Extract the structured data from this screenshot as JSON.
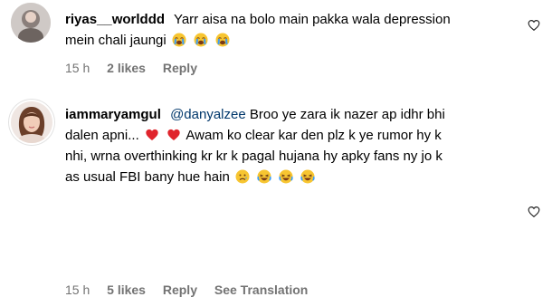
{
  "comments": [
    {
      "username": "riyas__worlddd",
      "text_parts": [
        "Yarr aisa na bolo main pakka wala depression",
        "mein chali jaungi"
      ],
      "emojis": [
        "crying-face",
        "crying-face",
        "crying-face"
      ],
      "time": "15 h",
      "likes": "2 likes",
      "reply": "Reply"
    },
    {
      "username": "iammaryamgul",
      "mention": "@danyalzee",
      "text_lines": [
        "Broo ye zara ik nazer ap idhr bhi",
        "dalen apni...",
        "Awam ko clear kar den plz k ye rumor hy k",
        "nhi, wrna overthinking kr kr k pagal hujana hy apky fans ny jo k",
        "as usual FBI bany hue hain"
      ],
      "emojis": [
        "red-heart",
        "red-heart",
        "sad-face",
        "laughing-face",
        "laughing-face",
        "laughing-face"
      ],
      "time": "15 h",
      "likes": "5 likes",
      "reply": "Reply",
      "translation": "See Translation"
    }
  ],
  "colors": {
    "meta": "#737373",
    "mention": "#00376b",
    "heart_outline": "#262626"
  }
}
